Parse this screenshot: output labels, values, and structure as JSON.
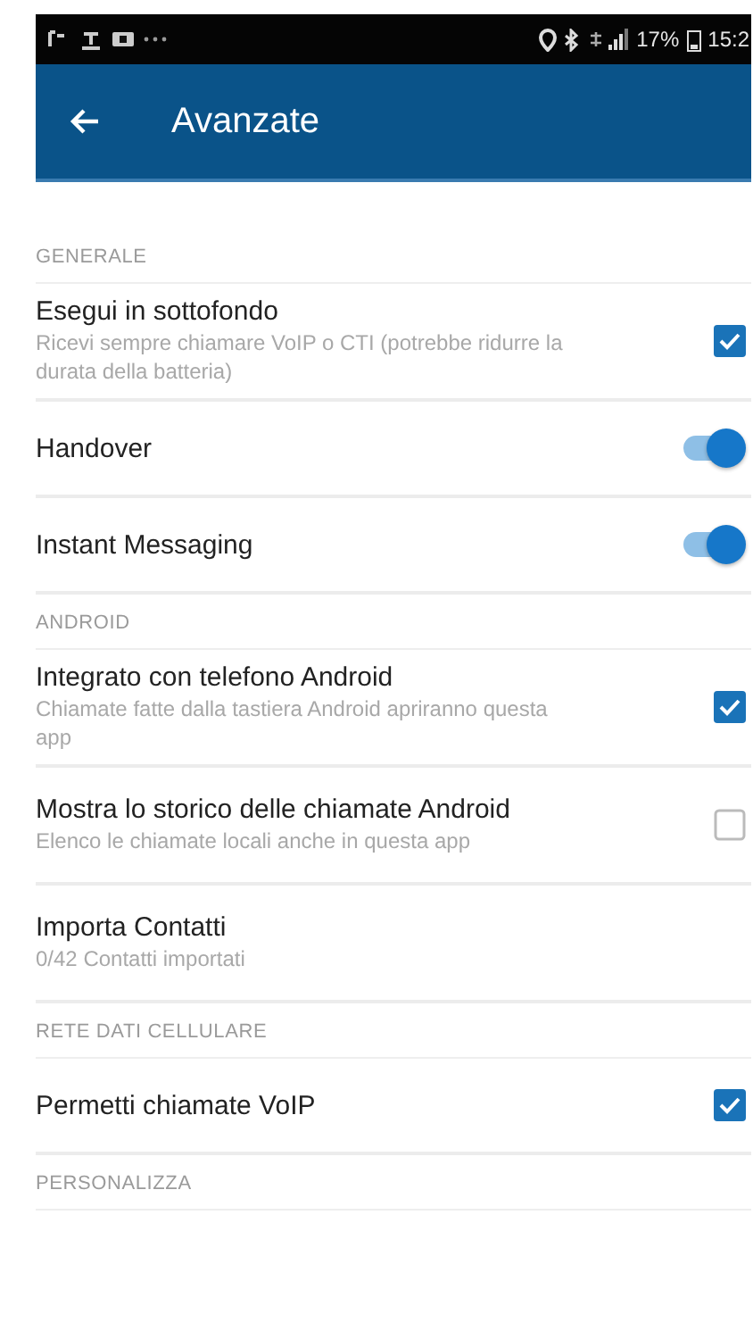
{
  "status_bar": {
    "battery": "17%",
    "time": "15:2"
  },
  "app_bar": {
    "title": "Avanzate"
  },
  "sections": [
    {
      "header": "GENERALE",
      "items": [
        {
          "kind": "checkbox",
          "title": "Esegui in sottofondo",
          "subtitle": "Ricevi sempre chiamare VoIP o CTI (potrebbe ridurre la durata della batteria)",
          "checked": true
        },
        {
          "kind": "switch",
          "title": "Handover",
          "on": true
        },
        {
          "kind": "switch",
          "title": "Instant Messaging",
          "on": true
        }
      ]
    },
    {
      "header": "ANDROID",
      "items": [
        {
          "kind": "checkbox",
          "title": "Integrato con telefono Android",
          "subtitle": "Chiamate fatte dalla tastiera Android apriranno questa app",
          "checked": true
        },
        {
          "kind": "checkbox",
          "title": "Mostra lo storico delle chiamate Android",
          "subtitle": "Elenco le chiamate locali anche in questa app",
          "checked": false
        },
        {
          "kind": "plain",
          "title": "Importa Contatti",
          "subtitle": "0/42 Contatti importati"
        }
      ]
    },
    {
      "header": "RETE DATI CELLULARE",
      "items": [
        {
          "kind": "checkbox",
          "title": "Permetti chiamate VoIP",
          "checked": true
        }
      ]
    },
    {
      "header": "PERSONALIZZA"
    }
  ]
}
